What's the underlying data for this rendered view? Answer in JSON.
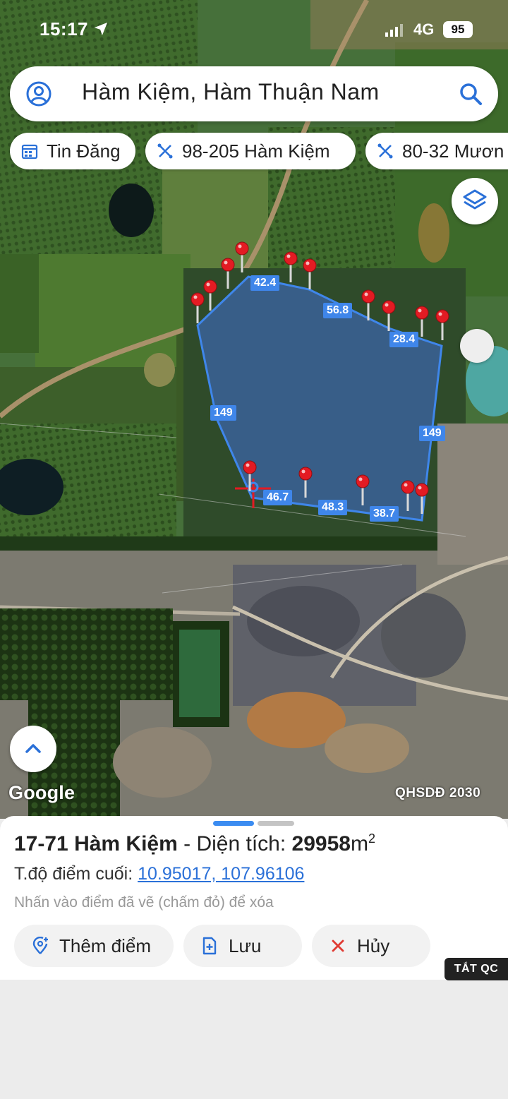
{
  "status": {
    "time": "15:17",
    "network": "4G",
    "battery": "95"
  },
  "search": {
    "query": "Hàm Kiệm, Hàm Thuận Nam"
  },
  "chips": [
    {
      "label": "Tin Đăng",
      "icon": "calendar-icon"
    },
    {
      "label": "98-205 Hàm Kiệm",
      "icon": "ruler-icon"
    },
    {
      "label": "80-32 Mươn",
      "icon": "ruler-icon"
    }
  ],
  "map": {
    "segment_labels": [
      "42.4",
      "56.8",
      "28.4",
      "149",
      "149",
      "46.7",
      "48.3",
      "38.7"
    ],
    "google_label": "Google",
    "plan_label": "QHSDĐ 2030",
    "polygon_color": "#3f86ea",
    "marker_color": "#e31b23"
  },
  "sheet": {
    "parcel": "17-71 Hàm Kiệm",
    "area_prefix": " - Diện tích: ",
    "area_value": "29958",
    "area_unit": "m",
    "area_sup": "2",
    "coord_label": "T.độ điểm cuối: ",
    "coord_value": "10.95017, 107.96106",
    "hint": "Nhấn vào điểm đã vẽ (chấm đỏ) để xóa",
    "buttons": {
      "add": "Thêm điểm",
      "save": "Lưu",
      "cancel": "Hủy"
    }
  },
  "ad": {
    "hide_label": "TẮT QC"
  }
}
